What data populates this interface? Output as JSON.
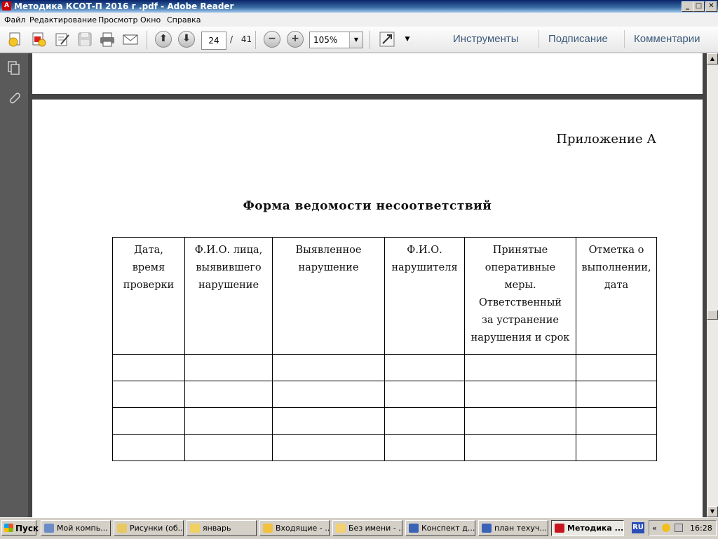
{
  "window": {
    "title": "Методика КСОТ-П 2016 г .pdf - Adobe Reader",
    "app_icon": "adobe-reader-icon",
    "minimize": "_",
    "maximize": "□",
    "close": "✕"
  },
  "menu": [
    "Файл",
    "Редактирование",
    "Просмотр",
    "Окно",
    "Справка"
  ],
  "toolbar": {
    "page_current": "24",
    "page_separator": "/",
    "page_total": "41",
    "zoom": "105%",
    "right_tabs": [
      "Инструменты",
      "Подписание",
      "Комментарии"
    ]
  },
  "document": {
    "appendix_label": "Приложение А",
    "form_title": "Форма ведомости несоответствий",
    "table": {
      "headers": [
        [
          "Дата,",
          "время",
          "проверки"
        ],
        [
          "Ф.И.О. лица,",
          "выявившего",
          "нарушение"
        ],
        [
          "Выявленное",
          "нарушение"
        ],
        [
          "Ф.И.О.",
          "нарушителя"
        ],
        [
          "Принятые",
          "оперативные",
          "меры.",
          "Ответственный",
          "за устранение",
          "нарушения и срок"
        ],
        [
          "Отметка о",
          "выполнении,",
          "дата"
        ]
      ],
      "empty_rows": 4
    }
  },
  "taskbar": {
    "start": "Пуск",
    "tasks": [
      {
        "label": "Мой компь...",
        "icon": "computer-icon"
      },
      {
        "label": "Рисунки (об...",
        "icon": "folder-image-icon"
      },
      {
        "label": "январь",
        "icon": "folder-icon"
      },
      {
        "label": "Входящие - ...",
        "icon": "mail-inbox-icon"
      },
      {
        "label": "Без имени - ...",
        "icon": "mail-compose-icon"
      },
      {
        "label": "Конспект д...",
        "icon": "word-document-icon"
      },
      {
        "label": "план техуч...",
        "icon": "word-document-icon"
      },
      {
        "label": "Методика ...",
        "icon": "pdf-icon",
        "active": true
      }
    ],
    "language": "RU",
    "clock": "16:28"
  },
  "colors": {
    "title_bar": "#0a246a",
    "doc_background": "#444444",
    "tool_tab_text": "#3c5a7a"
  }
}
